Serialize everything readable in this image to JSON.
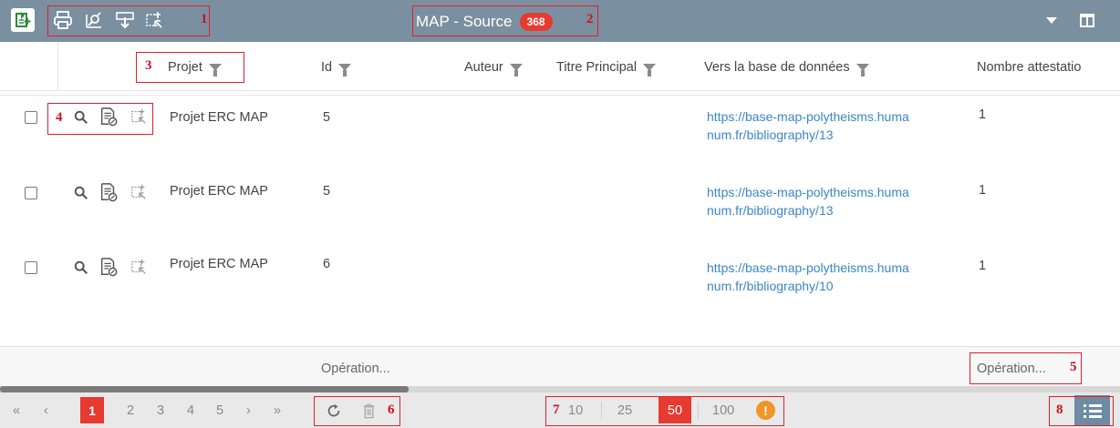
{
  "window": {
    "title": "MAP - Source",
    "count": "368"
  },
  "toolbar": {
    "icons": [
      "add-record-icon",
      "print-icon",
      "chart-search-icon",
      "export-down-icon",
      "select-edit-icon"
    ]
  },
  "columns": {
    "projet": "Projet",
    "id": "Id",
    "auteur": "Auteur",
    "titre": "Titre Principal",
    "vers_base": "Vers la base de données",
    "nombre": "Nombre attestatio"
  },
  "rows": [
    {
      "projet": "Projet ERC MAP",
      "id": "5",
      "link_line1": "https://base-map-polytheisms.huma",
      "link_line2": "num.fr/bibliography/13",
      "nombre": "1"
    },
    {
      "projet": "Projet ERC MAP",
      "id": "5",
      "link_line1": "https://base-map-polytheisms.huma",
      "link_line2": "num.fr/bibliography/13",
      "nombre": "1"
    },
    {
      "projet": "Projet ERC MAP",
      "id": "6",
      "link_line1": "https://base-map-polytheisms.huma",
      "link_line2": "num.fr/bibliography/10",
      "nombre": "1"
    }
  ],
  "footer": {
    "operation_left": "Opération...",
    "operation_right": "Opération..."
  },
  "pager": {
    "first": "«",
    "prev": "‹",
    "pages": [
      "1",
      "2",
      "3",
      "4",
      "5"
    ],
    "next": "›",
    "last": "»",
    "sizes": [
      "10",
      "25",
      "50",
      "100"
    ],
    "warning": "!"
  },
  "annotations": [
    "1",
    "2",
    "3",
    "4",
    "5",
    "6",
    "7",
    "8"
  ],
  "colors": {
    "titlebar": "#7a8fa0",
    "accent_red": "#e73a30",
    "link": "#3a86c8",
    "warning": "#f0952a"
  }
}
